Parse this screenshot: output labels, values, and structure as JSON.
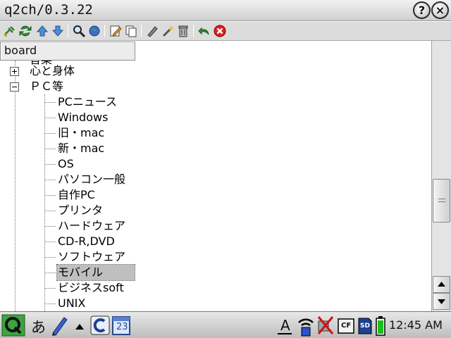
{
  "window": {
    "title": "q2ch/0.3.22",
    "help_label": "?",
    "close_label": "×"
  },
  "toolbar": {
    "buttons": [
      {
        "icon": "connect-icon"
      },
      {
        "icon": "refresh-icon"
      },
      {
        "icon": "arrow-up-icon"
      },
      {
        "icon": "arrow-down-icon"
      },
      {
        "icon": "search-icon"
      },
      {
        "icon": "globe-icon"
      },
      {
        "icon": "edit-icon"
      },
      {
        "icon": "copy-icon"
      },
      {
        "icon": "pen-icon"
      },
      {
        "icon": "wand-icon"
      },
      {
        "icon": "trash-icon"
      },
      {
        "icon": "undo-icon"
      },
      {
        "icon": "stop-icon"
      }
    ]
  },
  "board_combo": {
    "value": "board"
  },
  "tree": {
    "partial_item": "音楽",
    "categories": [
      {
        "label": "心と身体",
        "expanded": false
      },
      {
        "label": "ＰＣ等",
        "expanded": true
      }
    ],
    "pc_children": [
      "PCニュース",
      "Windows",
      "旧・mac",
      "新・mac",
      "OS",
      "パソコン一般",
      "自作PC",
      "プリンタ",
      "ハードウェア",
      "CD-R,DVD",
      "ソフトウェア",
      "モバイル",
      "ビジネスsoft",
      "UNIX"
    ],
    "selected_item": "モバイル"
  },
  "taskbar": {
    "input_mode": "あ",
    "keyboard_label": "A",
    "cf_label": "CF",
    "sd_label": "SD",
    "calendar_day": "23",
    "clock": "12:45 AM"
  },
  "colors": {
    "selection": "#bfbfbf",
    "toolbar_bg": "#dcdcdc",
    "taskbar_bg": "#cfcfcf"
  }
}
